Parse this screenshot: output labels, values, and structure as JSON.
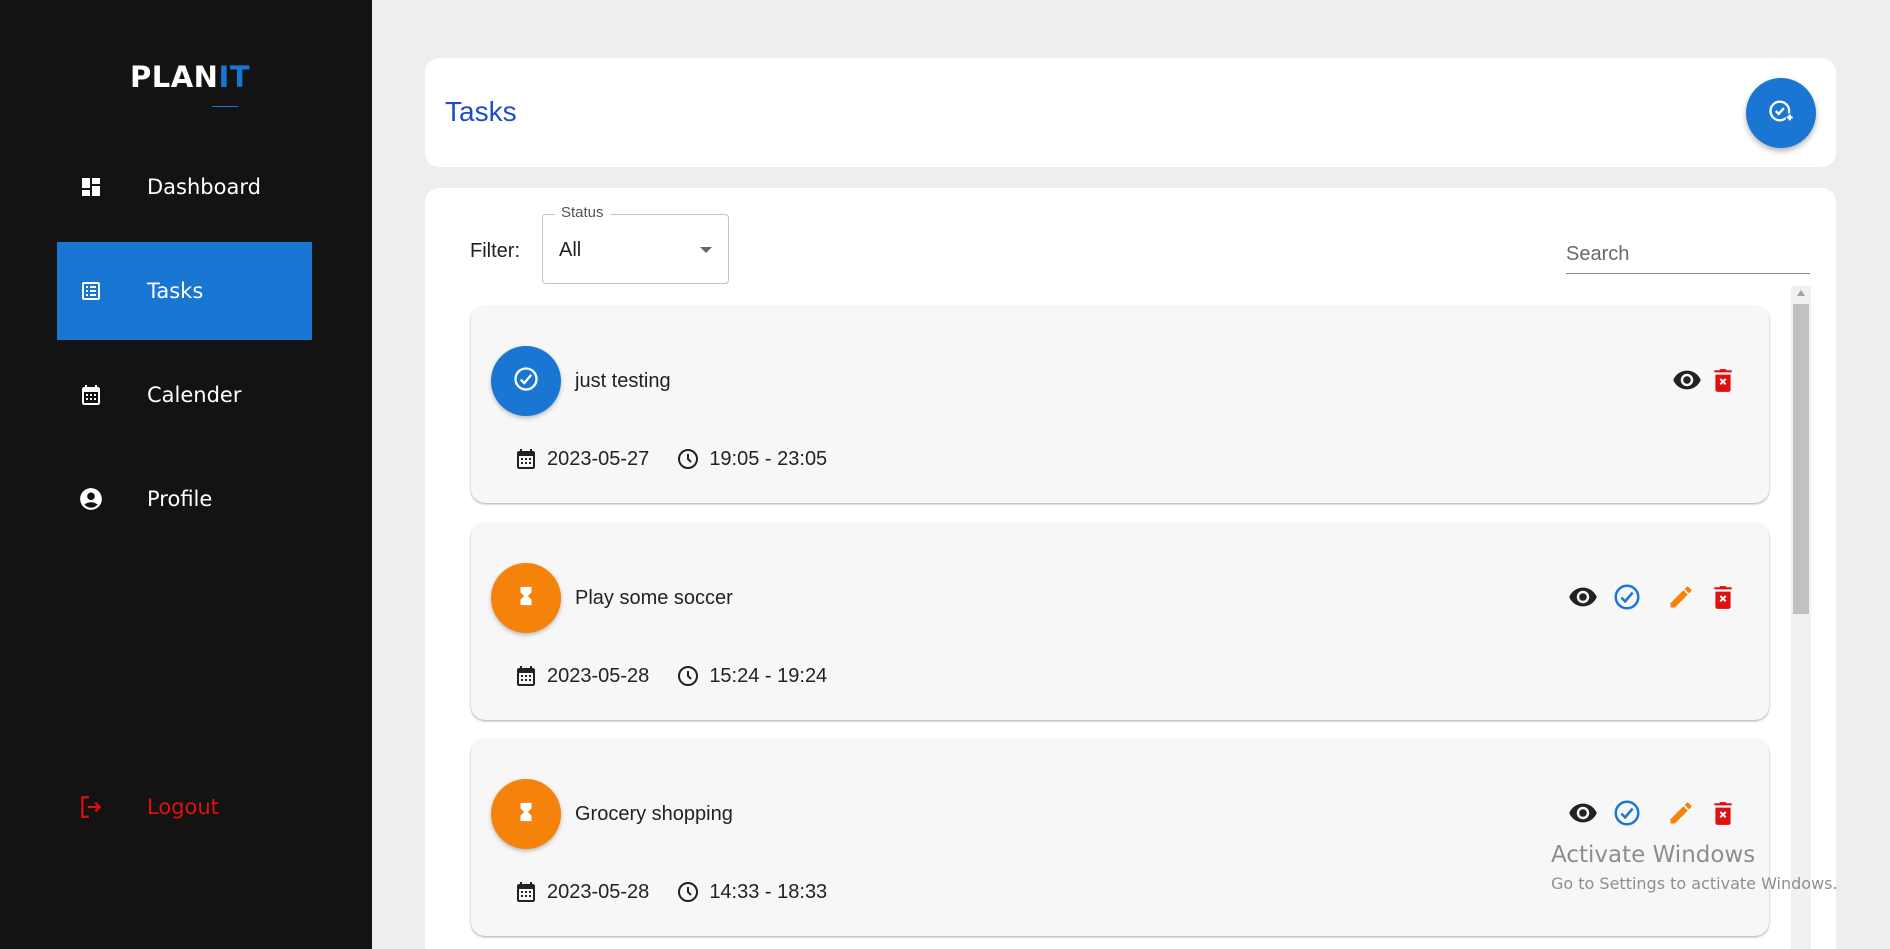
{
  "app": {
    "logo_main": "PLAN",
    "logo_accent": "IT"
  },
  "sidebar": {
    "items": [
      {
        "label": "Dashboard",
        "icon": "dashboard-icon"
      },
      {
        "label": "Tasks",
        "icon": "task-list-icon",
        "active": true
      },
      {
        "label": "Calender",
        "icon": "calendar-icon"
      },
      {
        "label": "Profile",
        "icon": "account-circle-icon"
      }
    ],
    "logout": {
      "label": "Logout",
      "icon": "logout-icon"
    }
  },
  "header": {
    "title": "Tasks",
    "add_button_icon": "add-task-icon"
  },
  "filter": {
    "label": "Filter:",
    "status_legend": "Status",
    "status_value": "All"
  },
  "search": {
    "placeholder": "Search"
  },
  "tasks": [
    {
      "title": "just testing",
      "date": "2023-05-27",
      "time": "19:05 - 23:05",
      "status": "completed",
      "actions": [
        "view",
        "delete"
      ]
    },
    {
      "title": "Play some soccer",
      "date": "2023-05-28",
      "time": "15:24 - 19:24",
      "status": "pending",
      "actions": [
        "view",
        "complete",
        "edit",
        "delete"
      ]
    },
    {
      "title": "Grocery shopping",
      "date": "2023-05-28",
      "time": "14:33 - 18:33",
      "status": "pending",
      "actions": [
        "view",
        "complete",
        "edit",
        "delete"
      ]
    }
  ],
  "colors": {
    "accent": "#1976d2",
    "pending": "#f5820a",
    "delete": "#e01010",
    "sidebar_bg": "#131313"
  },
  "watermark": {
    "line1": "Activate Windows",
    "line2": "Go to Settings to activate Windows."
  }
}
